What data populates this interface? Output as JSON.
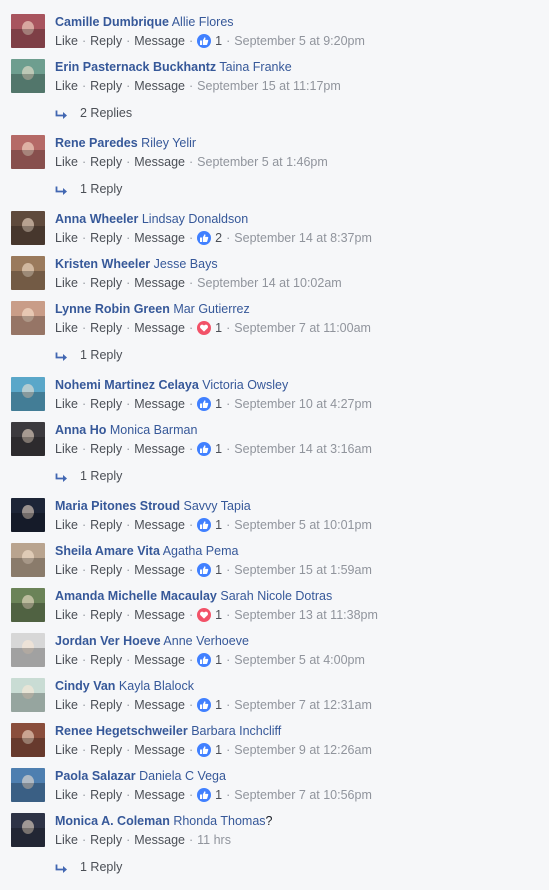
{
  "actions": {
    "like": "Like",
    "reply": "Reply",
    "message": "Message"
  },
  "colors": {
    "author_link": "#365899",
    "meta_text": "#90949c",
    "like_reaction": "#4080ff",
    "love_reaction": "#f25268"
  },
  "comments": [
    {
      "author": "Camille Dumbrique",
      "tagged": "Allie Flores",
      "reaction": {
        "icon": "like-reaction-icon",
        "count": "1"
      },
      "time": "September 5 at 9:20pm",
      "avatar_color": "#a8545e"
    },
    {
      "author": "Erin Pasternack Buckhantz",
      "tagged": "Taina Franke",
      "time": "September 15 at 11:17pm",
      "replies": "2 Replies",
      "avatar_color": "#6e9e8f"
    },
    {
      "author": "Rene Paredes",
      "tagged": "Riley Yelir",
      "time": "September 5 at 1:46pm",
      "replies": "1 Reply",
      "avatar_color": "#b56a67"
    },
    {
      "author": "Anna Wheeler",
      "tagged": "Lindsay Donaldson",
      "reaction": {
        "icon": "like-reaction-icon",
        "count": "2"
      },
      "time": "September 14 at 8:37pm",
      "avatar_color": "#5f4a3c"
    },
    {
      "author": "Kristen Wheeler",
      "tagged": "Jesse Bays",
      "time": "September 14 at 10:02am",
      "avatar_color": "#9a7a5c"
    },
    {
      "author": "Lynne Robin Green",
      "tagged": "Mar Gutierrez",
      "reaction": {
        "icon": "love-reaction-icon",
        "count": "1"
      },
      "time": "September 7 at 11:00am",
      "replies": "1 Reply",
      "avatar_color": "#c99d88"
    },
    {
      "author": "Nohemi Martinez Celaya",
      "tagged": "Victoria Owsley",
      "reaction": {
        "icon": "like-reaction-icon",
        "count": "1"
      },
      "time": "September 10 at 4:27pm",
      "avatar_color": "#5aa7c9"
    },
    {
      "author": "Anna Ho",
      "tagged": "Monica Barman",
      "reaction": {
        "icon": "like-reaction-icon",
        "count": "1"
      },
      "time": "September 14 at 3:16am",
      "replies": "1 Reply",
      "avatar_color": "#3c3a3e"
    },
    {
      "author": "Maria Pitones Stroud",
      "tagged": "Savvy Tapia",
      "reaction": {
        "icon": "like-reaction-icon",
        "count": "1"
      },
      "time": "September 5 at 10:01pm",
      "avatar_color": "#1d2537"
    },
    {
      "author": "Sheila Amare Vita",
      "tagged": "Agatha Pema",
      "reaction": {
        "icon": "like-reaction-icon",
        "count": "1"
      },
      "time": "September 15 at 1:59am",
      "avatar_color": "#b9a48f"
    },
    {
      "author": "Amanda Michelle Macaulay",
      "tagged": "Sarah Nicole Dotras",
      "reaction": {
        "icon": "love-reaction-icon",
        "count": "1"
      },
      "time": "September 13 at 11:38pm",
      "avatar_color": "#6b8358"
    },
    {
      "author": "Jordan Ver Hoeve",
      "tagged": "Anne Verhoeve",
      "reaction": {
        "icon": "like-reaction-icon",
        "count": "1"
      },
      "time": "September 5 at 4:00pm",
      "avatar_color": "#d7d7d7"
    },
    {
      "author": "Cindy Van",
      "tagged": "Kayla Blalock",
      "reaction": {
        "icon": "like-reaction-icon",
        "count": "1"
      },
      "time": "September 7 at 12:31am",
      "avatar_color": "#c9dcd4"
    },
    {
      "author": "Renee Hegetschweiler",
      "tagged": "Barbara Inchcliff",
      "reaction": {
        "icon": "like-reaction-icon",
        "count": "1"
      },
      "time": "September 9 at 12:26am",
      "avatar_color": "#8a4e3c"
    },
    {
      "author": "Paola Salazar",
      "tagged": "Daniela C Vega",
      "reaction": {
        "icon": "like-reaction-icon",
        "count": "1"
      },
      "time": "September 7 at 10:56pm",
      "avatar_color": "#4e7fb0"
    },
    {
      "author": "Monica A. Coleman",
      "tagged": "Rhonda Thomas",
      "tagged_suffix": "?",
      "time": "11 hrs",
      "replies": "1 Reply",
      "avatar_color": "#2e3346"
    }
  ]
}
